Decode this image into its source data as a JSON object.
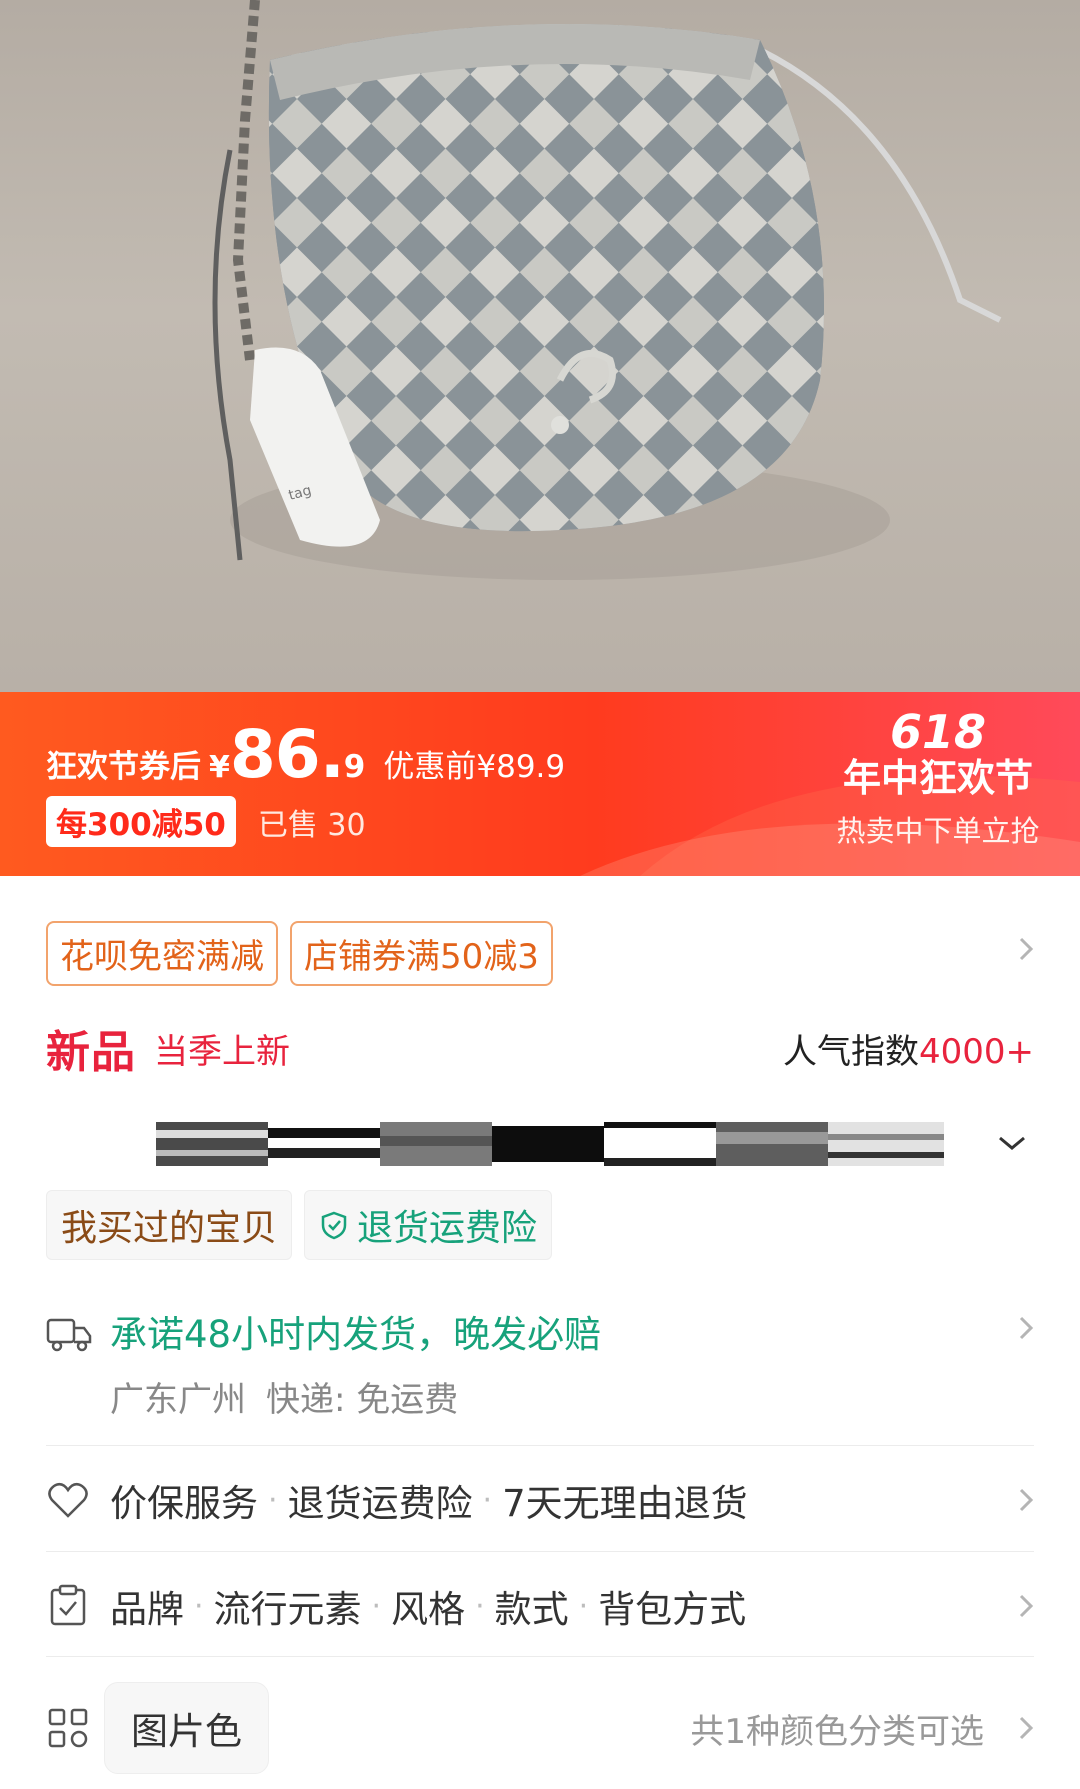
{
  "hero": {
    "icon": "product-photo-woven-bucket-bag"
  },
  "promo": {
    "tag": "狂欢节券后",
    "currency": "¥",
    "price_int": "86.",
    "price_dec": "9",
    "orig_price": "优惠前¥89.9",
    "coupon": "每300减50",
    "sold": "已售 30",
    "fest_number": "618",
    "fest_title": "年中狂欢节",
    "fest_sub": "热卖中下单立抢"
  },
  "coupons": [
    "花呗免密满减",
    "店铺券满50减3"
  ],
  "new_row": {
    "badge": "新品",
    "sub": "当季上新",
    "pop_label": "人气指数",
    "pop_value": "4000+"
  },
  "service_tags": {
    "bought": "我买过的宝贝",
    "insurance": "退货运费险"
  },
  "delivery": {
    "promise": "承诺48小时内发货，晚发必赔",
    "location": "广东广州",
    "express": "快递: 免运费"
  },
  "guarantee": {
    "items": [
      "价保服务",
      "退货运费险",
      "7天无理由退货"
    ]
  },
  "params": {
    "items": [
      "品牌",
      "流行元素",
      "风格",
      "款式",
      "背包方式"
    ]
  },
  "color": {
    "option": "图片色",
    "count": "共1种颜色分类可选"
  },
  "colors": {
    "accent_red": "#e8233d",
    "banner_orange": "#ff4a1e",
    "green": "#17a27b"
  }
}
